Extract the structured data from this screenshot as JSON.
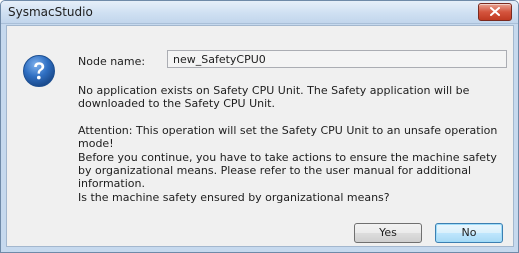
{
  "window": {
    "title": "SysmacStudio"
  },
  "dialog": {
    "icon": "question-icon",
    "node_label": "Node name:",
    "node_value": "new_SafetyCPU0",
    "message_1": "No application exists on Safety CPU Unit. The Safety application will be downloaded to the Safety CPU Unit.",
    "message_2": "Attention: This operation will set the Safety CPU Unit to an unsafe operation mode!",
    "message_3": "Before you continue, you have to take actions to ensure the machine safety by organizational means. Please refer to the user manual for additional information.",
    "message_4": "Is the machine safety ensured by organizational means?"
  },
  "buttons": {
    "yes_label": "Yes",
    "no_label": "No"
  },
  "colors": {
    "accent": "#3c7fb1",
    "close": "#c03a22",
    "icon_blue": "#2f6fc2"
  }
}
